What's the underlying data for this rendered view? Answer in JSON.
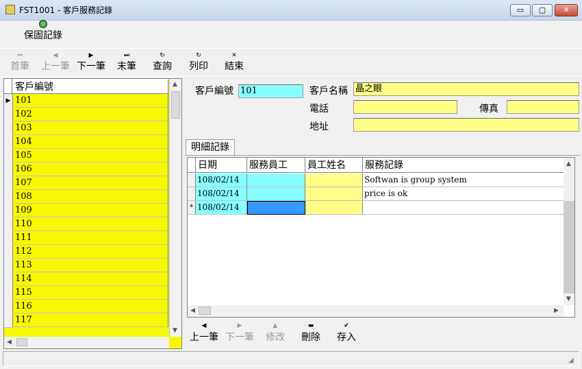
{
  "window": {
    "title": "FST1001 - 客戶服務記錄",
    "min": "▭",
    "max": "▢",
    "close": "✕"
  },
  "top_toolbar": {
    "save_record": "保固記錄"
  },
  "nav_toolbar": [
    {
      "label": "首筆",
      "icon": "⏮",
      "enabled": false
    },
    {
      "label": "上一筆",
      "icon": "◀",
      "enabled": false
    },
    {
      "label": "下一筆",
      "icon": "▶",
      "enabled": true
    },
    {
      "label": "末筆",
      "icon": "⏭",
      "enabled": true
    },
    {
      "label": "查詢",
      "icon": "↻",
      "enabled": true
    },
    {
      "label": "列印",
      "icon": "↻",
      "enabled": true
    },
    {
      "label": "結束",
      "icon": "✕",
      "enabled": true
    }
  ],
  "customer_list": {
    "header": "客戶編號",
    "rows": [
      "101",
      "102",
      "103",
      "104",
      "105",
      "106",
      "107",
      "108",
      "109",
      "110",
      "111",
      "112",
      "113",
      "114",
      "115",
      "116",
      "117"
    ]
  },
  "customer_form": {
    "id_label": "客戶編號",
    "id_value": "101",
    "name_label": "客戶名稱",
    "name_value": "晶之眼",
    "phone_label": "電話",
    "phone_value": "",
    "fax_label": "傳真",
    "fax_value": "",
    "address_label": "地址",
    "address_value": ""
  },
  "detail_tab": {
    "label": "明細記錄"
  },
  "detail_grid": {
    "headers": [
      "日期",
      "服務員工",
      "員工姓名",
      "服務記錄"
    ],
    "rows": [
      {
        "marker": "",
        "date": "108/02/14",
        "employee": "",
        "employee_name": "",
        "record": "Softwan is group system"
      },
      {
        "marker": "",
        "date": "108/02/14",
        "employee": "",
        "employee_name": "",
        "record": "price is ok"
      },
      {
        "marker": "*",
        "date": "108/02/14",
        "employee": "",
        "employee_name": "",
        "record": ""
      }
    ]
  },
  "detail_nav": [
    {
      "label": "上一筆",
      "icon": "◀",
      "enabled": true
    },
    {
      "label": "下一筆",
      "icon": "▶",
      "enabled": false
    },
    {
      "label": "修改",
      "icon": "▲",
      "enabled": false
    },
    {
      "label": "刪除",
      "icon": "▬",
      "enabled": true
    },
    {
      "label": "存入",
      "icon": "✔",
      "enabled": true
    }
  ]
}
